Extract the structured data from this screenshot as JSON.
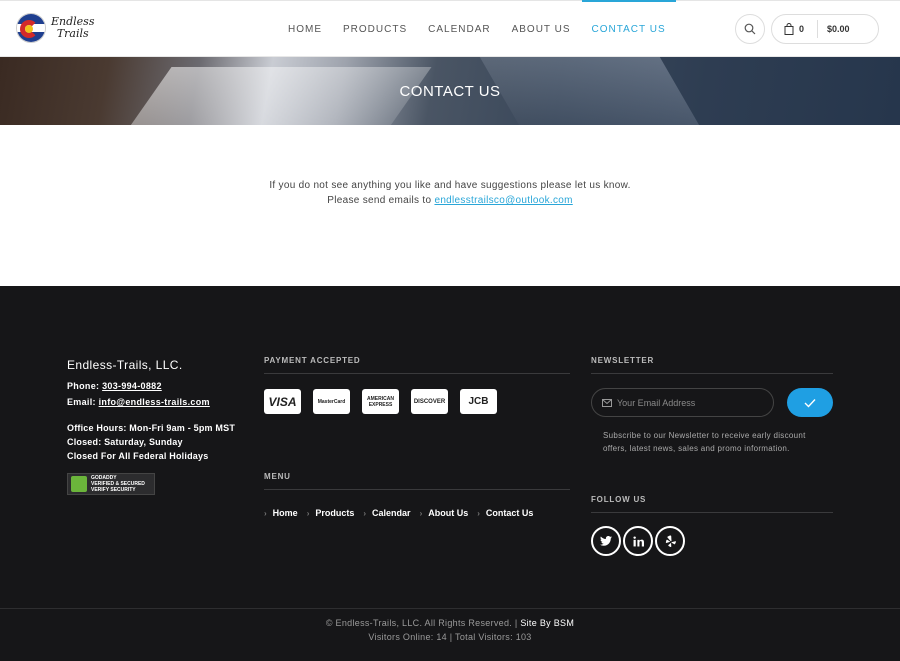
{
  "header": {
    "logo_line1": "Endless",
    "logo_line2": "Trails",
    "nav": [
      "HOME",
      "PRODUCTS",
      "CALENDAR",
      "ABOUT US",
      "CONTACT US"
    ],
    "active_nav": "CONTACT US",
    "cart_count": "0",
    "cart_total": "$0.00"
  },
  "banner": {
    "title": "CONTACT US"
  },
  "content": {
    "line1": "If you do not see anything you like and have suggestions please let us know.",
    "line2_prefix": "Please send emails to ",
    "email": "endlesstrailsco@outlook.com"
  },
  "footer": {
    "company": "Endless-Trails, LLC.",
    "phone_label": "Phone: ",
    "phone": "303-994-0882",
    "email_label": "Email: ",
    "email": "info@endless-trails.com",
    "hours": [
      "Office Hours: Mon-Fri 9am - 5pm MST",
      "Closed: Saturday, Sunday",
      "Closed For All Federal Holidays"
    ],
    "seal": {
      "line1": "GODADDY",
      "line2": "VERIFIED & SECURED",
      "line3": "VERIFY SECURITY"
    },
    "payment_title": "PAYMENT ACCEPTED",
    "cards": [
      "VISA",
      "MasterCard",
      "AMERICAN EXPRESS",
      "DISCOVER",
      "JCB"
    ],
    "menu_title": "MENU",
    "menu": [
      "Home",
      "Products",
      "Calendar",
      "About Us",
      "Contact Us"
    ],
    "newsletter_title": "NEWSLETTER",
    "newsletter_placeholder": "Your Email Address",
    "newsletter_text_1": "Subscribe to our Newsletter to receive early discount",
    "newsletter_text_2": "offers, latest news, sales and promo information.",
    "follow_title": "FOLLOW US",
    "socials": [
      "twitter-icon",
      "linkedin-icon",
      "yelp-icon"
    ],
    "copyright": "© Endless-Trails, LLC. All Rights Reserved. | ",
    "site_by": "Site By BSM",
    "visitors": "Visitors Online: 14 | Total Visitors: 103"
  },
  "colors": {
    "accent": "#29a6d8",
    "footer_bg": "#161618",
    "submit": "#1f9fe3"
  }
}
